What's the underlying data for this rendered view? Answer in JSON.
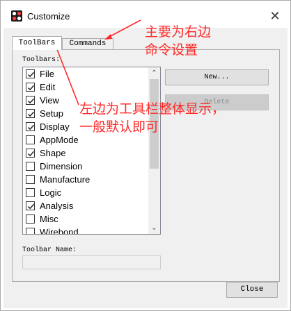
{
  "window": {
    "title": "Customize",
    "close_glyph": "✕",
    "icon": "app-logo-icon"
  },
  "tabs": [
    {
      "label": "ToolBars",
      "active": true
    },
    {
      "label": "Commands",
      "active": false
    }
  ],
  "toolbars_panel": {
    "list_label": "Toolbars:",
    "items": [
      {
        "label": "File",
        "checked": true
      },
      {
        "label": "Edit",
        "checked": true
      },
      {
        "label": "View",
        "checked": true
      },
      {
        "label": "Setup",
        "checked": true
      },
      {
        "label": "Display",
        "checked": true
      },
      {
        "label": "AppMode",
        "checked": false
      },
      {
        "label": "Shape",
        "checked": true
      },
      {
        "label": "Dimension",
        "checked": false
      },
      {
        "label": "Manufacture",
        "checked": false
      },
      {
        "label": "Logic",
        "checked": false
      },
      {
        "label": "Analysis",
        "checked": true
      },
      {
        "label": "Misc",
        "checked": false
      },
      {
        "label": "Wirebond",
        "checked": false
      }
    ],
    "new_button": "New...",
    "delete_button": "Delete",
    "name_label": "Toolbar Name:",
    "name_value": ""
  },
  "close_button": "Close",
  "annotations": {
    "top": [
      "主要为右边",
      "命令设置"
    ],
    "middle": [
      "左边为工具栏整体显示，",
      "一般默认即可"
    ],
    "color": "#ff2a2a"
  },
  "colors": {
    "dialog_bg": "#f0f0f0",
    "button_bg": "#e1e1e1",
    "annotation_red": "#ff2a2a"
  }
}
